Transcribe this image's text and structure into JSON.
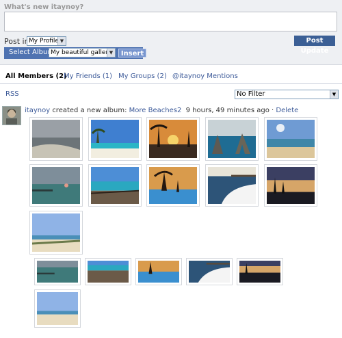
{
  "composer": {
    "prompt": "What's new itaynoy?",
    "status_value": "",
    "post_in_label": "Post in:",
    "post_in_selected": "My Profile",
    "select_album_label": "Select Album:",
    "album_selected": "My beautiful gallery",
    "insert_label": "Insert",
    "post_button_label": "Post Update"
  },
  "tabs": [
    {
      "label": "All Members (2)",
      "active": true
    },
    {
      "label": "My Friends (1)",
      "active": false
    },
    {
      "label": "My Groups (2)",
      "active": false
    },
    {
      "label": "@itaynoy Mentions",
      "active": false
    }
  ],
  "rss_label": "RSS",
  "filter_selected": "No Filter",
  "activity": {
    "user": "itaynoy",
    "action": "created a new album:",
    "album_link": "More Beaches2",
    "time": "9 hours, 49 minutes ago",
    "separator": "·",
    "delete_label": "Delete"
  },
  "photos": [
    {
      "icon": "beach-photo"
    },
    {
      "icon": "beach-photo"
    },
    {
      "icon": "beach-photo"
    },
    {
      "icon": "beach-photo"
    },
    {
      "icon": "beach-photo"
    },
    {
      "icon": "beach-photo"
    },
    {
      "icon": "beach-photo"
    },
    {
      "icon": "beach-photo"
    },
    {
      "icon": "beach-photo"
    },
    {
      "icon": "beach-photo"
    },
    {
      "icon": "beach-photo"
    }
  ],
  "palette": {
    "link": "#3b5998",
    "button_blue": "#3b5f95",
    "album_bar": "#4f73b1"
  }
}
